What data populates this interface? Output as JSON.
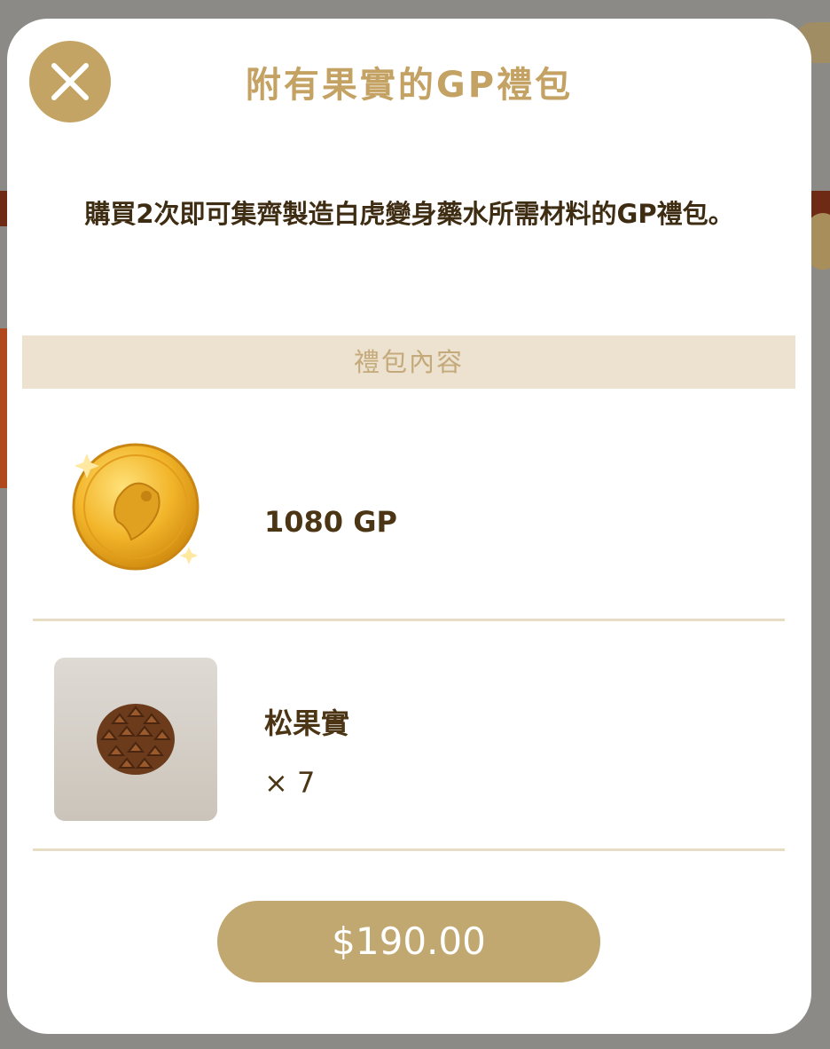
{
  "modal": {
    "title": "附有果實的GP禮包",
    "description": "購買2次即可集齊製造白虎變身藥水所需材料的GP禮包。",
    "section_header": "禮包內容",
    "close_icon": "close-icon",
    "items": [
      {
        "name": "1080 GP",
        "icon": "gold-coin-icon"
      },
      {
        "name": "松果實",
        "quantity": "× 7",
        "icon": "pine-cone-icon"
      }
    ],
    "price_label": "$190.00"
  },
  "colors": {
    "accent": "#c4a465",
    "price_button": "#c1a871",
    "section_header_bg": "#ece2cf",
    "text_dark": "#4b3514"
  }
}
